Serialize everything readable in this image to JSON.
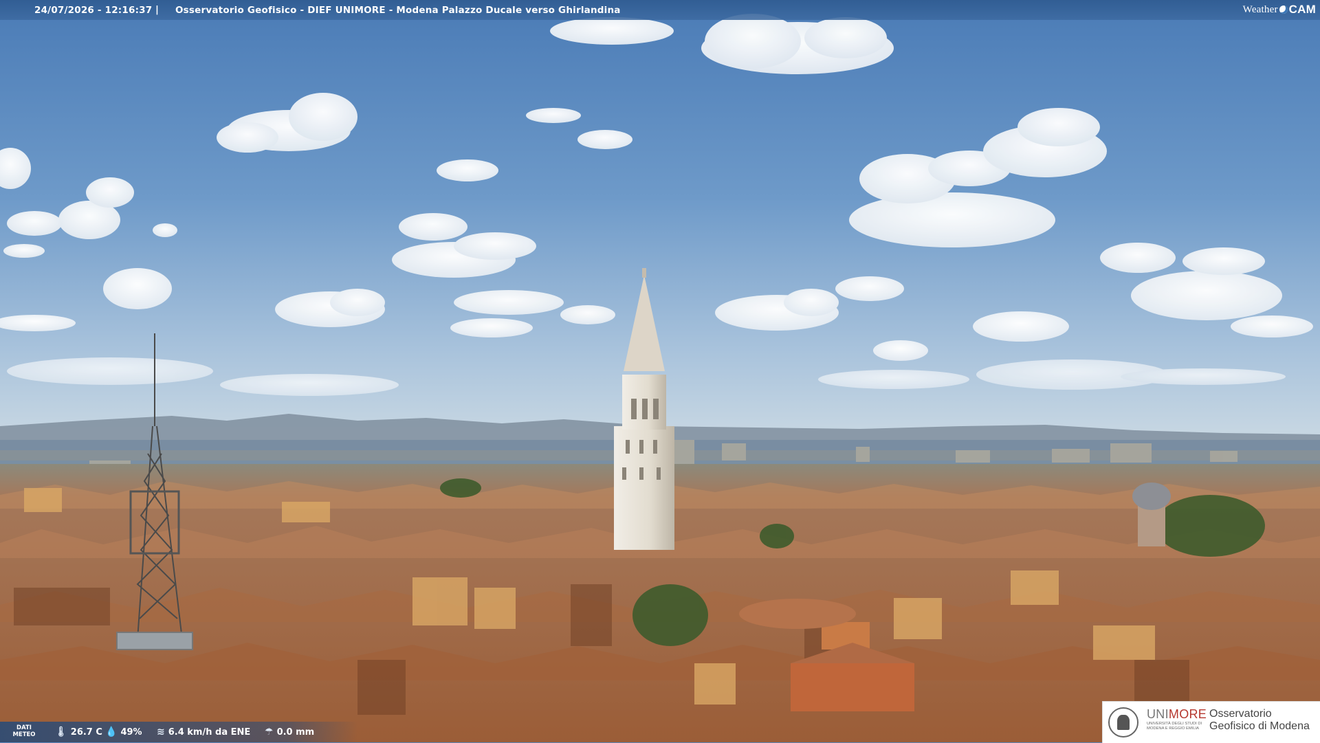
{
  "caption": {
    "timestamp": "24/07/2026 - 12:16:37",
    "separator": "|",
    "title": "Osservatorio Geofisico - DIEF UNIMORE - Modena Palazzo Ducale verso Ghirlandina"
  },
  "brand": {
    "part1": "Weather",
    "part2": "CAM"
  },
  "weather": {
    "label": "DATI METEO",
    "temperature": "26.7 C",
    "humidity": "49%",
    "wind": "6.4 km/h da ENE",
    "rain": "0.0 mm",
    "icons": [
      "thermometer-icon",
      "humidity-icon",
      "wind-icon",
      "rain-icon"
    ]
  },
  "logo": {
    "uni_grey": "UNI",
    "uni_red": "MORE",
    "uni_sub": "UNIVERSITÀ DEGLI STUDI DI MODENA E REGGIO EMILIA",
    "observatory": "Osservatorio Geofisico di Modena"
  },
  "colors": {
    "sky_top": "#4f7fb9",
    "sky_horizon": "#b7cde0",
    "roofs": "#b77b4f",
    "tower": "#e7e1d6",
    "unimore_red": "#b5372e"
  }
}
